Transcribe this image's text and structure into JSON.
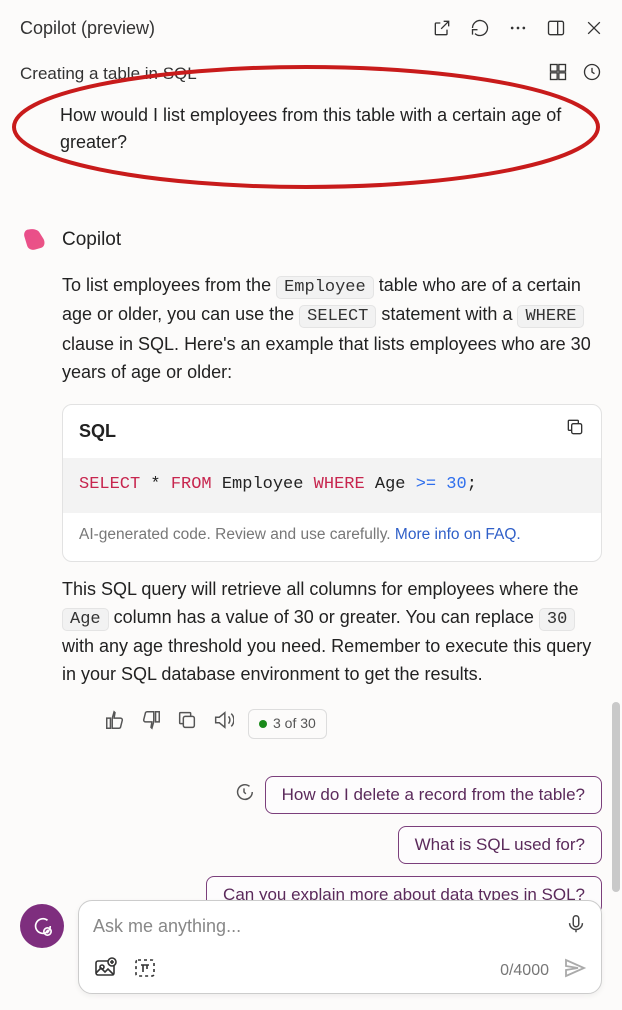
{
  "header": {
    "title": "Copilot (preview)"
  },
  "topic": {
    "title": "Creating a table in SQL"
  },
  "user": {
    "question": "How would I list employees from this table with a certain age of greater?"
  },
  "response": {
    "name": "Copilot",
    "para1_a": "To list employees from the ",
    "code1": "Employee",
    "para1_b": " table who are of a certain age or older, you can use the ",
    "code2": "SELECT",
    "para1_c": " statement with a ",
    "code3": "WHERE",
    "para1_d": " clause in SQL. Here's an example that lists employees who are 30 years of age or older:",
    "code_lang": "SQL",
    "sql": {
      "select": "SELECT",
      "star": " * ",
      "from": "FROM",
      "table": " Employee ",
      "where": "WHERE",
      "col": " Age ",
      "op": ">=",
      "val": " 30",
      "semi": ";"
    },
    "note_text": "AI-generated code. Review and use carefully. ",
    "note_link": "More info on FAQ.",
    "para2_a": "This SQL query will retrieve all columns for employees where the ",
    "code4": "Age",
    "para2_b": " column has a value of 30 or greater. You can replace ",
    "code5": "30",
    "para2_c": " with any age threshold you need. Remember to execute this query in your SQL database environment to get the results.",
    "counter": "3 of 30"
  },
  "suggestions": [
    "How do I delete a record from the table?",
    "What is SQL used for?",
    "Can you explain more about data types in SQL?"
  ],
  "input": {
    "placeholder": "Ask me anything...",
    "counter": "0/4000"
  }
}
